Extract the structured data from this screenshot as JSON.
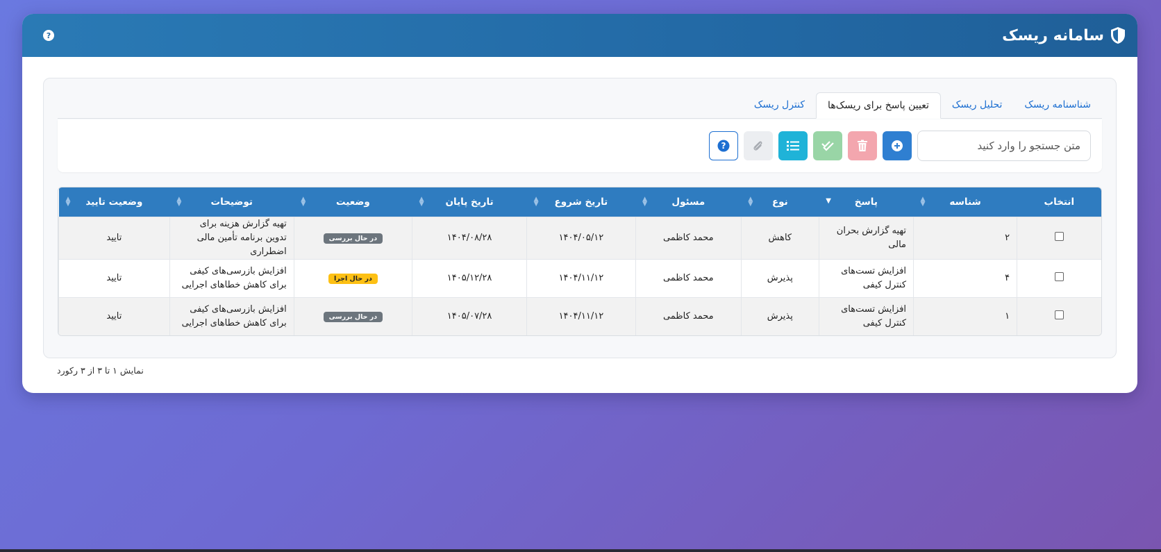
{
  "header": {
    "title": "سامانه ریسک",
    "help": "?"
  },
  "tabs": [
    {
      "label": "شناسنامه ریسک",
      "active": false
    },
    {
      "label": "تحلیل ریسک",
      "active": false
    },
    {
      "label": "تعیین پاسخ برای ریسک‌ها",
      "active": true
    },
    {
      "label": "کنترل ریسک",
      "active": false
    }
  ],
  "search": {
    "placeholder": "متن جستجو را وارد کنید",
    "value": ""
  },
  "toolbar_icons": {
    "add": "plus-circle-icon",
    "delete": "trash-icon",
    "approve": "check-double-icon",
    "list": "list-icon",
    "attach": "paperclip-icon",
    "help": "question-circle-icon"
  },
  "table": {
    "columns": [
      "انتخاب",
      "شناسه",
      "پاسخ",
      "نوع",
      "مسئول",
      "تاریخ شروع",
      "تاریخ پایان",
      "وضعیت",
      "توضیحات",
      "وضعیت تایید"
    ],
    "rows": [
      {
        "id": "۲",
        "response": "تهیه گزارش بحران مالی",
        "type": "کاهش",
        "owner": "محمد کاظمی",
        "start": "۱۴۰۴/۰۵/۱۲",
        "end": "۱۴۰۴/۰۸/۲۸",
        "status": "در حال بررسی",
        "desc": "تهیه گزارش هزینه برای تدوین برنامه تأمین مالی اضطراری",
        "approval": "تایید"
      },
      {
        "id": "۴",
        "response": "افزایش تست‌های کنترل کیفی",
        "type": "پذیرش",
        "owner": "محمد کاظمی",
        "start": "۱۴۰۴/۱۱/۱۲",
        "end": "۱۴۰۵/۱۲/۲۸",
        "status": "در حال اجرا",
        "desc": "افزایش بازرسی‌های کیفی برای کاهش خطاهای اجرایی",
        "approval": "تایید"
      },
      {
        "id": "۱",
        "response": "افزایش تست‌های کنترل کیفی",
        "type": "پذیرش",
        "owner": "محمد کاظمی",
        "start": "۱۴۰۴/۱۱/۱۲",
        "end": "۱۴۰۵/۰۷/۲۸",
        "status": "در حال بررسی",
        "desc": "افزایش بازرسی‌های کیفی برای کاهش خطاهای اجرایی",
        "approval": "تایید"
      }
    ]
  },
  "footer": {
    "summary": "نمایش ۱ تا ۳ از ۳ رکورد"
  },
  "colors": {
    "header": "#236aa6",
    "table_header": "#2f7cc0",
    "tab_link": "#1d6fd1",
    "badge_review": "#6c757d",
    "badge_running": "#fdc014"
  }
}
